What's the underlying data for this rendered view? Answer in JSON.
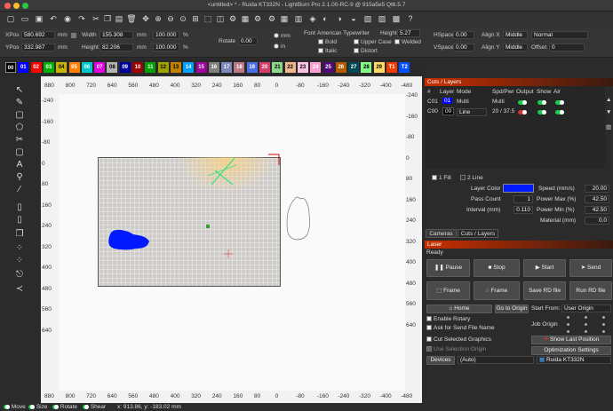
{
  "window": {
    "title": "<untitled> * - Ruida KT332N - LightBurn Pro 2.1.00-RC-9 @ 915a5e5 Qt6.5.7"
  },
  "colors": {
    "accent_orange": "#c83000",
    "blue_shape": "#0019ff",
    "layer_c01": "#0000ff",
    "layer_c00": "#000000",
    "toggle_on": "#19c94b"
  },
  "toolbar": {
    "icons": [
      "new-file-icon",
      "open-folder-icon",
      "save-icon",
      "undo-icon",
      "redo-icon",
      "lightburn-icon",
      "cut-icon",
      "copy-icon",
      "paste-icon",
      "delete-icon",
      "move-icon",
      "zoom-in-icon",
      "zoom-out-icon",
      "zoom-fit-icon",
      "zoom-window-icon",
      "frame-icon",
      "trace-icon",
      "settings-icon",
      "camera-icon",
      "laser-icon",
      "gear-icon",
      "grid-icon",
      "align-icon",
      "node-icon",
      "weld-icon",
      "boolean-icon",
      "offset-icon",
      "preview-icon",
      "laser-tools-icon",
      "layout-icon",
      "help-icon"
    ]
  },
  "props": {
    "xpos_label": "XPos",
    "xpos_value": "580.692",
    "xpos_unit": "mm",
    "ypos_label": "YPos",
    "ypos_value": "332.987",
    "ypos_unit": "mm",
    "width_label": "Width",
    "width_value": "155.308",
    "width_unit": "mm",
    "height_label": "Height",
    "height_value": "82.206",
    "height_unit": "mm",
    "scale_x": "100.000",
    "scale_y": "100.000",
    "pct": "%",
    "rotate_label": "Rotate",
    "rotate_value": "0.00",
    "unit_mm": "mm",
    "unit_in": "in",
    "font_name": "American Typewriter",
    "font_label": "Font",
    "font_height_label": "Height",
    "font_height_value": "5.27",
    "bold_label": "Bold",
    "italic_label": "Italic",
    "upper_case_label": "Upper Case",
    "welded_label": "Welded",
    "distort_label": "Distort",
    "hspace_label": "HSpace",
    "hspace_value": "0.00",
    "vspace_label": "VSpace",
    "vspace_value": "0.00",
    "alignx_label": "Align X",
    "alignx_value": "Middle",
    "aligny_label": "Align Y",
    "aligny_value": "Middle",
    "normal_value": "Normal",
    "offset_label": "Offset",
    "offset_value": "0"
  },
  "palette": {
    "items": [
      {
        "label": "00",
        "color": "#000000"
      },
      {
        "label": "01",
        "color": "#0000ff"
      },
      {
        "label": "02",
        "color": "#ff0000"
      },
      {
        "label": "03",
        "color": "#00b000"
      },
      {
        "label": "04",
        "color": "#c8b400"
      },
      {
        "label": "05",
        "color": "#ff7f00"
      },
      {
        "label": "06",
        "color": "#00c8c8"
      },
      {
        "label": "07",
        "color": "#e000e0"
      },
      {
        "label": "08",
        "color": "#b4b4b4"
      },
      {
        "label": "09",
        "color": "#0000a0"
      },
      {
        "label": "10",
        "color": "#a00000"
      },
      {
        "label": "11",
        "color": "#00a000"
      },
      {
        "label": "12",
        "color": "#a0a000"
      },
      {
        "label": "13",
        "color": "#c08000"
      },
      {
        "label": "14",
        "color": "#00a0ff"
      },
      {
        "label": "15",
        "color": "#a000a0"
      },
      {
        "label": "16",
        "color": "#808080"
      },
      {
        "label": "17",
        "color": "#7d87b9"
      },
      {
        "label": "18",
        "color": "#bb7784"
      },
      {
        "label": "19",
        "color": "#4a6fe3"
      },
      {
        "label": "20",
        "color": "#d33f6a"
      },
      {
        "label": "21",
        "color": "#8cd78c"
      },
      {
        "label": "22",
        "color": "#f0b98d"
      },
      {
        "label": "23",
        "color": "#f6c4e1"
      },
      {
        "label": "24",
        "color": "#fa9ed4"
      },
      {
        "label": "25",
        "color": "#500a78"
      },
      {
        "label": "26",
        "color": "#b45a00"
      },
      {
        "label": "27",
        "color": "#004754"
      },
      {
        "label": "28",
        "color": "#86fa88"
      },
      {
        "label": "29",
        "color": "#ffdb66"
      },
      {
        "label": "T1",
        "color": "#f03c00"
      },
      {
        "label": "T2",
        "color": "#0050ff"
      }
    ]
  },
  "ruler": {
    "top": [
      "880",
      "800",
      "720",
      "640",
      "560",
      "480",
      "400",
      "320",
      "240",
      "160",
      "80",
      "0",
      "-80",
      "-160",
      "-240",
      "-320",
      "-400",
      "-480"
    ],
    "bottom": [
      "880",
      "800",
      "720",
      "640",
      "560",
      "480",
      "400",
      "320",
      "240",
      "160",
      "80",
      "0",
      "-80",
      "-160",
      "-240",
      "-320",
      "-400",
      "-480"
    ],
    "left": [
      "-240",
      "-160",
      "-80",
      "0",
      "80",
      "160",
      "240",
      "320",
      "400",
      "480",
      "560",
      "640"
    ],
    "right": [
      "-240",
      "-160",
      "-80",
      "0",
      "80",
      "160",
      "240",
      "320",
      "400",
      "480",
      "560",
      "640"
    ]
  },
  "cuts": {
    "title": "Cuts / Layers",
    "headers": [
      "#",
      "Layer",
      "Mode",
      "Spd/Pwr",
      "Output",
      "Show",
      "Air"
    ],
    "rows": [
      {
        "num": "C01",
        "layer": "01",
        "mode": "Multi",
        "spdpwr": "Multi"
      },
      {
        "num": "C00",
        "layer": "00",
        "mode": "Line",
        "spdpwr": "20 / 37.5"
      }
    ],
    "sublayer_1": "1 Fill",
    "sublayer_2": "2 Line",
    "layer_color_label": "Layer Color",
    "speed_label": "Speed (mm/s)",
    "speed_value": "20.00",
    "pass_label": "Pass Count",
    "pass_value": "1",
    "pmax_label": "Power Max (%)",
    "pmax_value": "42.50",
    "interval_label": "Interval (mm)",
    "interval_value": "0.110",
    "pmin_label": "Power Min (%)",
    "pmin_value": "42.50",
    "material_label": "Material (mm)",
    "material_value": "0.0"
  },
  "tabs": {
    "cameras": "Cameras",
    "cuts": "Cuts / Layers"
  },
  "laser": {
    "title": "Laser",
    "status": "Ready",
    "pause": "Pause",
    "stop": "Stop",
    "start": "Start",
    "send": "Send",
    "frame1": "Frame",
    "frame2": "Frame",
    "save_rd": "Save RD file",
    "run_rd": "Run RD file",
    "home": "Home",
    "go_origin": "Go to Origin",
    "start_from_label": "Start From:",
    "start_from_value": "User Origin",
    "enable_rotary": "Enable Rotary",
    "ask_send": "Ask for Send File Name",
    "job_origin": "Job Origin",
    "cut_selected": "Cut Selected Graphics",
    "use_selection": "Use Selection Origin",
    "show_last": "Show Last Position",
    "optimization": "Optimization Settings",
    "devices": "Devices",
    "auto": "(Auto)",
    "device_name": "Ruida KT332N"
  },
  "status": {
    "move": "Move",
    "size": "Size",
    "rotate": "Rotate",
    "shear": "Shear",
    "coords": "x: 913.86, y: -183.02 mm"
  }
}
